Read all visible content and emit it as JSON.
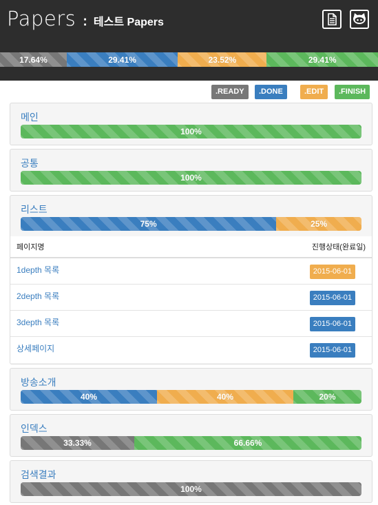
{
  "header": {
    "brand": "Papers",
    "separator": ":",
    "project": "테스트 Papers",
    "icons": [
      "document-icon",
      "github-cat-icon"
    ]
  },
  "overall_progress": [
    {
      "status": "ready",
      "percent": 17.64,
      "label": "17.64%"
    },
    {
      "status": "done",
      "percent": 29.41,
      "label": "29.41%"
    },
    {
      "status": "edit",
      "percent": 23.52,
      "label": "23.52%"
    },
    {
      "status": "finish",
      "percent": 29.41,
      "label": "29.41%"
    }
  ],
  "legend": {
    "ready": ".READY",
    "done": ".DONE",
    "edit": ".EDIT",
    "finish": ".FINISH"
  },
  "colors": {
    "ready": "#777777",
    "done": "#3a7ebf",
    "edit": "#f0ad4e",
    "finish": "#5cb85c",
    "header_bg": "#2d2d2d"
  },
  "sections": [
    {
      "title": "메인",
      "segments": [
        {
          "status": "finish",
          "percent": 100,
          "label": "100%"
        }
      ]
    },
    {
      "title": "공통",
      "segments": [
        {
          "status": "finish",
          "percent": 100,
          "label": "100%"
        }
      ]
    },
    {
      "title": "리스트",
      "segments": [
        {
          "status": "done",
          "percent": 75,
          "label": "75%"
        },
        {
          "status": "edit",
          "percent": 25,
          "label": "25%"
        }
      ],
      "table": {
        "headers": {
          "page": "페이지명",
          "status": "진행상태(완료일)"
        },
        "rows": [
          {
            "page": "1depth 목록",
            "date": "2015-06-01",
            "status": "edit"
          },
          {
            "page": "2depth 목록",
            "date": "2015-06-01",
            "status": "done"
          },
          {
            "page": "3depth 목록",
            "date": "2015-06-01",
            "status": "done"
          },
          {
            "page": "상세페이지",
            "date": "2015-06-01",
            "status": "done"
          }
        ]
      }
    },
    {
      "title": "방송소개",
      "segments": [
        {
          "status": "done",
          "percent": 40,
          "label": "40%"
        },
        {
          "status": "edit",
          "percent": 40,
          "label": "40%"
        },
        {
          "status": "finish",
          "percent": 20,
          "label": "20%"
        }
      ]
    },
    {
      "title": "인덱스",
      "segments": [
        {
          "status": "ready",
          "percent": 33.33,
          "label": "33.33%"
        },
        {
          "status": "finish",
          "percent": 66.66,
          "label": "66.66%"
        }
      ]
    },
    {
      "title": "검색결과",
      "segments": [
        {
          "status": "ready",
          "percent": 100,
          "label": "100%"
        }
      ]
    }
  ]
}
